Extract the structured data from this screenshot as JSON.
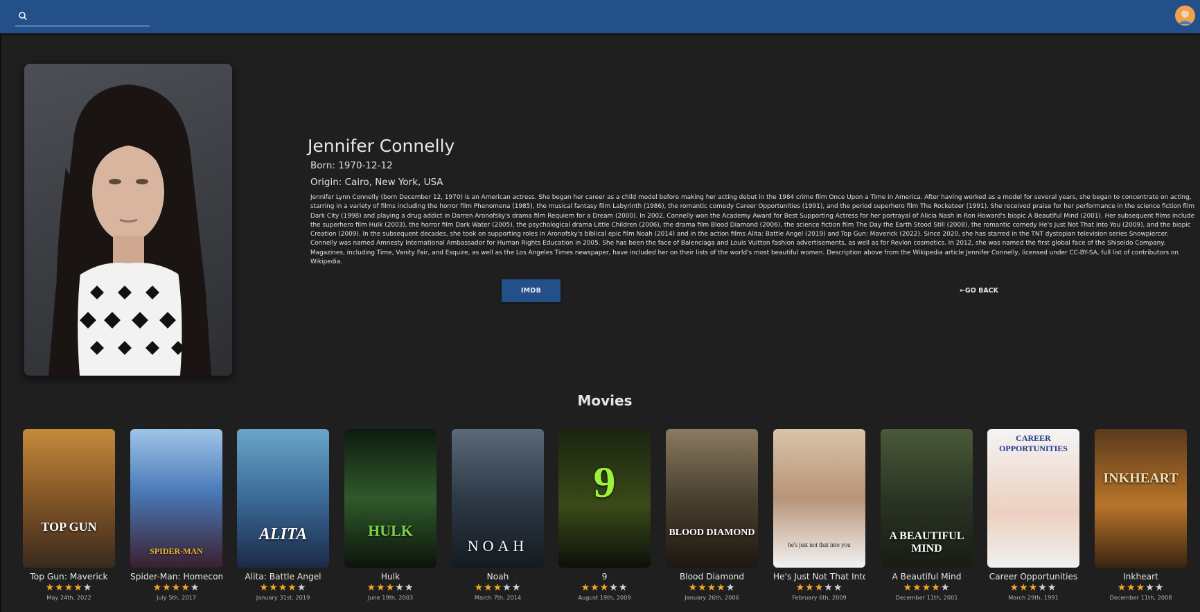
{
  "header": {
    "search_placeholder": "",
    "search_icon": "search-icon",
    "avatar_icon": "user-avatar-icon"
  },
  "actor": {
    "name": "Jennifer Connelly",
    "born": "Born: 1970-12-12",
    "origin": "Origin: Cairo, New York, USA",
    "bio": "Jennifer Lynn Connelly (born December 12, 1970) is an American actress. She began her career as a child model before making her acting debut in the 1984 crime film Once Upon a Time in America. After having worked as a model for several years, she began to concentrate on acting, starring in a variety of films including the horror film Phenomena (1985), the musical fantasy film Labyrinth (1986), the romantic comedy Career Opportunities (1991), and the period superhero film The Rocketeer (1991). She received praise for her performance in the science fiction film Dark City (1998) and playing a drug addict in Darren Aronofsky's drama film Requiem for a Dream (2000). In 2002, Connelly won the Academy Award for Best Supporting Actress for her portrayal of Alicia Nash in Ron Howard's biopic A Beautiful Mind (2001). Her subsequent films include the superhero film Hulk (2003), the horror film Dark Water (2005), the psychological drama Little Children (2006), the drama film Blood Diamond (2006), the science fiction film The Day the Earth Stood Still (2008), the romantic comedy He's Just Not That Into You (2009), and the biopic Creation (2009). In the subsequent decades, she took on supporting roles in Aronofsky's biblical epic film Noah (2014) and in the action films Alita: Battle Angel (2019) and Top Gun: Maverick (2022). Since 2020, she has starred in the TNT dystopian television series Snowpiercer. Connelly was named Amnesty International Ambassador for Human Rights Education in 2005. She has been the face of Balenciaga and Louis Vuitton fashion advertisements, as well as for Revlon cosmetics. In 2012, she was named the first global face of the Shiseido Company. Magazines, including Time, Vanity Fair, and Esquire, as well as the Los Angeles Times newspaper, have included her on their lists of the world's most beautiful women. Description above from the Wikipedia article Jennifer Connelly, licensed under CC-BY-SA, full list of contributors on Wikipedia."
  },
  "buttons": {
    "imdb": "IMDB",
    "back": "←GO BACK"
  },
  "movies_heading": "Movies",
  "colors": {
    "accent": "#24508a",
    "background": "#1f1f20",
    "star": "#f5a623"
  },
  "movies": [
    {
      "title": "Top Gun: Maverick",
      "poster_text": "TOP GUN",
      "rating": 4.5,
      "date": "May 24th, 2022"
    },
    {
      "title": "Spider-Man: Homecoming",
      "poster_text": "SPIDER-MAN",
      "rating": 4.5,
      "date": "July 5th, 2017"
    },
    {
      "title": "Alita: Battle Angel",
      "poster_text": "ALITA",
      "rating": 4.5,
      "date": "January 31st, 2019"
    },
    {
      "title": "Hulk",
      "poster_text": "HULK",
      "rating": 3,
      "date": "June 19th, 2003"
    },
    {
      "title": "Noah",
      "poster_text": "NOAH",
      "rating": 3,
      "date": "March 7th, 2014"
    },
    {
      "title": "9",
      "poster_text": "9",
      "rating": 3.5,
      "date": "August 19th, 2009"
    },
    {
      "title": "Blood Diamond",
      "poster_text": "BLOOD DIAMOND",
      "rating": 4.5,
      "date": "January 26th, 2006"
    },
    {
      "title": "He's Just Not That Into You",
      "poster_text": "he's just not that into you",
      "rating": 3,
      "date": "February 6th, 2009"
    },
    {
      "title": "A Beautiful Mind",
      "poster_text": "A BEAUTIFUL MIND",
      "rating": 4.5,
      "date": "December 11th, 2001"
    },
    {
      "title": "Career Opportunities",
      "poster_text": "CAREER OPPORTUNITIES",
      "rating": 3.5,
      "date": "March 29th, 1991"
    },
    {
      "title": "Inkheart",
      "poster_text": "INKHEART",
      "rating": 3,
      "date": "December 11th, 2008"
    }
  ]
}
